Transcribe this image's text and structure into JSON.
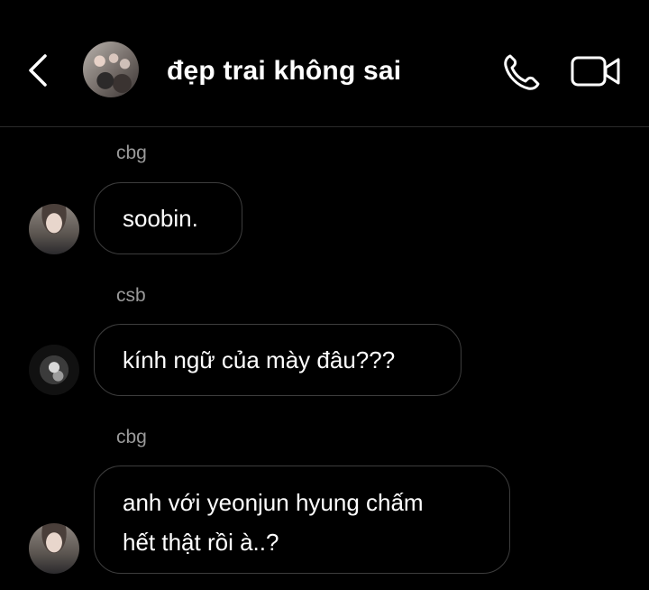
{
  "header": {
    "back_icon": "chevron-left-icon",
    "title": "đẹp trai không sai",
    "call_icon": "phone-icon",
    "video_icon": "video-camera-icon"
  },
  "messages": [
    {
      "sender": "cbg",
      "lines": [
        "soobin."
      ]
    },
    {
      "sender": "csb",
      "lines": [
        "kính ngữ của mày đâu???"
      ]
    },
    {
      "sender": "cbg",
      "lines": [
        "anh với yeonjun hyung chấm",
        "hết thật rồi à..?"
      ]
    }
  ],
  "colors": {
    "background": "#000000",
    "bubble_border": "#3d3d3d",
    "sender_text": "#9a9a9a",
    "message_text": "#ffffff",
    "divider": "#2a2a2a"
  }
}
